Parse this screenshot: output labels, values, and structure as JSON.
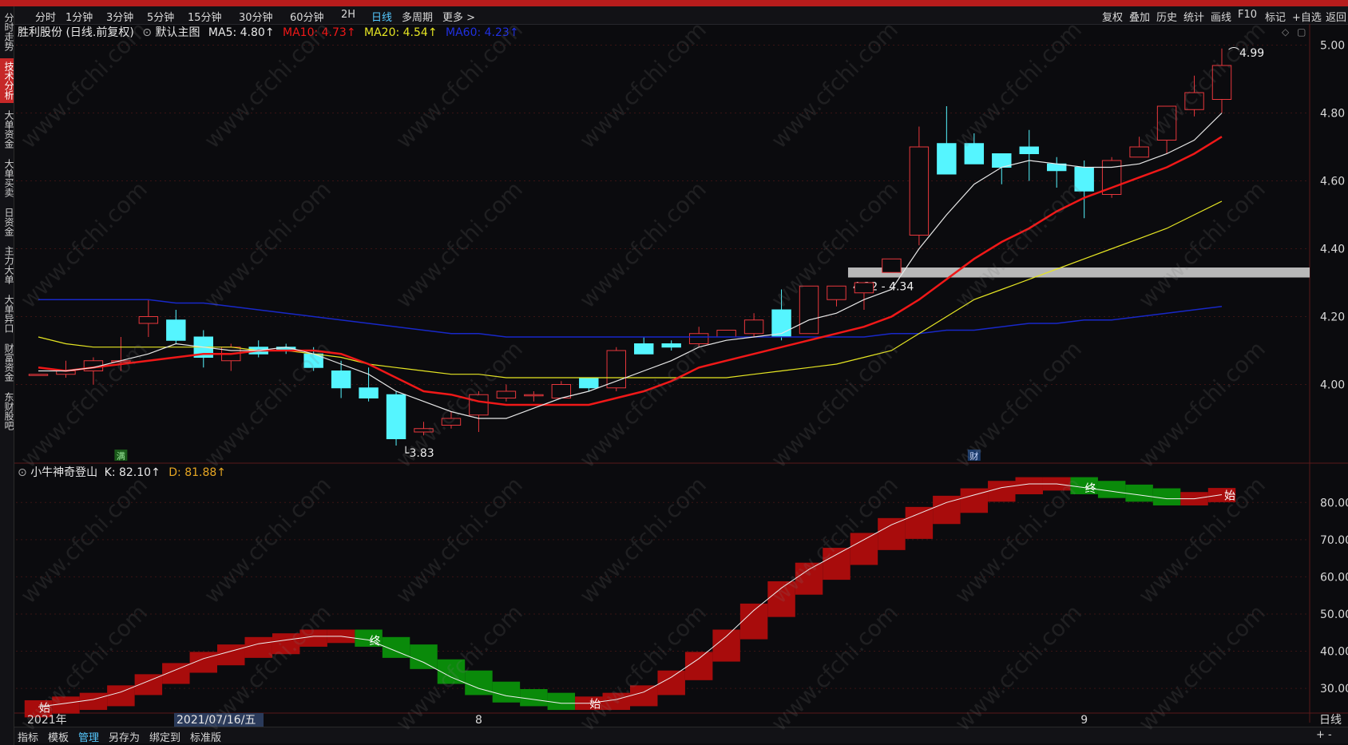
{
  "toolbar": {
    "timeframes": [
      "分时",
      "1分钟",
      "3分钟",
      "5分钟",
      "15分钟",
      "30分钟",
      "60分钟",
      "2H",
      "日线",
      "多周期",
      "更多 >"
    ],
    "active_timeframe": "日线",
    "right_buttons": [
      "复权",
      "叠加",
      "历史",
      "统计",
      "画线",
      "F10",
      "标记",
      "+自选",
      "返回"
    ]
  },
  "left_nav": [
    "分时走势",
    "技术分析",
    "大单资金",
    "大单买卖",
    "日资金",
    "主力大单",
    "大单异口",
    "财富资金",
    "东财股吧"
  ],
  "left_nav_active": "技术分析",
  "main_header": {
    "title": "胜利股份 (日线.前复权)",
    "indicator": "默认主图",
    "ma5": "MA5: 4.80↑",
    "ma10": "MA10: 4.73↑",
    "ma20": "MA20: 4.54↑",
    "ma60": "MA60: 4.23↑"
  },
  "colors": {
    "up": "#e8373c",
    "down": "#55f5ff",
    "ma5": "#e8e8e8",
    "ma10": "#f01818",
    "ma20": "#e6e623",
    "ma60": "#1828c8",
    "kbar_up": "#a80c0c",
    "kbar_down": "#0a8a0a",
    "bg": "#0b0b0e",
    "grid": "#3a1414"
  },
  "sub_header": {
    "title": "小牛神奇登山",
    "k": "K: 82.10↑",
    "d": "D: 81.88↑"
  },
  "annotations": {
    "low": "3.83",
    "high": "4.99",
    "zone": "4.32 - 4.34",
    "zone_low": 4.32,
    "zone_high": 4.34,
    "mark_man": "满",
    "mark_cai": "财",
    "sub_labels": [
      "始",
      "终",
      "始",
      "终",
      "始"
    ]
  },
  "x_axis": {
    "left": "2021年",
    "cursor_date": "2021/07/16/五",
    "month8": "8",
    "month9": "9",
    "right": "日线"
  },
  "bottom_tabs": [
    "指标",
    "模板",
    "管理",
    "另存为",
    "绑定到",
    "标准版"
  ],
  "bottom_active": "管理",
  "watermark": "www.cfchi.com",
  "chart_data": {
    "type": "candlestick",
    "price_axis": {
      "min": 3.78,
      "max": 5.02,
      "ticks": [
        4.0,
        4.2,
        4.4,
        4.6,
        4.8,
        5.0
      ]
    },
    "candles": [
      [
        4.03,
        4.03,
        4.04,
        4.04
      ],
      [
        4.03,
        4.04,
        4.07,
        4.02
      ],
      [
        4.04,
        4.07,
        4.08,
        4.0
      ],
      [
        4.07,
        4.07,
        4.14,
        4.04
      ],
      [
        4.18,
        4.2,
        4.25,
        4.14
      ],
      [
        4.19,
        4.13,
        4.22,
        4.12
      ],
      [
        4.14,
        4.08,
        4.16,
        4.05
      ],
      [
        4.07,
        4.11,
        4.12,
        4.04
      ],
      [
        4.11,
        4.09,
        4.13,
        4.08
      ],
      [
        4.11,
        4.1,
        4.12,
        4.09
      ],
      [
        4.09,
        4.05,
        4.11,
        4.04
      ],
      [
        4.04,
        3.99,
        4.07,
        3.96
      ],
      [
        3.99,
        3.96,
        4.05,
        3.95
      ],
      [
        3.97,
        3.84,
        3.98,
        3.82
      ],
      [
        3.86,
        3.87,
        3.89,
        3.85
      ],
      [
        3.88,
        3.9,
        3.92,
        3.87
      ],
      [
        3.91,
        3.97,
        3.98,
        3.86
      ],
      [
        3.96,
        3.98,
        4.0,
        3.95
      ],
      [
        3.97,
        3.97,
        3.98,
        3.95
      ],
      [
        3.96,
        4.0,
        4.01,
        3.96
      ],
      [
        4.02,
        3.99,
        4.02,
        3.98
      ],
      [
        3.99,
        4.1,
        4.11,
        3.98
      ],
      [
        4.12,
        4.09,
        4.14,
        4.09
      ],
      [
        4.12,
        4.11,
        4.13,
        4.1
      ],
      [
        4.12,
        4.15,
        4.17,
        4.11
      ],
      [
        4.14,
        4.16,
        4.16,
        4.14
      ],
      [
        4.15,
        4.19,
        4.21,
        4.14
      ],
      [
        4.22,
        4.14,
        4.28,
        4.13
      ],
      [
        4.15,
        4.29,
        4.29,
        4.16
      ],
      [
        4.25,
        4.29,
        4.29,
        4.23
      ],
      [
        4.27,
        4.3,
        4.3,
        4.22
      ],
      [
        4.33,
        4.37,
        4.37,
        4.33
      ],
      [
        4.44,
        4.7,
        4.76,
        4.41
      ],
      [
        4.71,
        4.62,
        4.82,
        4.62
      ],
      [
        4.71,
        4.65,
        4.74,
        4.65
      ],
      [
        4.68,
        4.64,
        4.68,
        4.59
      ],
      [
        4.7,
        4.68,
        4.75,
        4.6
      ],
      [
        4.65,
        4.63,
        4.67,
        4.58
      ],
      [
        4.64,
        4.57,
        4.66,
        4.49
      ],
      [
        4.56,
        4.66,
        4.67,
        4.55
      ],
      [
        4.67,
        4.7,
        4.73,
        4.67
      ],
      [
        4.72,
        4.82,
        4.82,
        4.68
      ],
      [
        4.81,
        4.86,
        4.91,
        4.79
      ],
      [
        4.84,
        4.94,
        4.99,
        4.8
      ]
    ],
    "ma5": [
      4.04,
      4.04,
      4.05,
      4.07,
      4.09,
      4.12,
      4.11,
      4.1,
      4.1,
      4.11,
      4.09,
      4.06,
      4.03,
      3.98,
      3.95,
      3.92,
      3.9,
      3.9,
      3.93,
      3.96,
      3.98,
      4.01,
      4.04,
      4.07,
      4.11,
      4.13,
      4.14,
      4.15,
      4.19,
      4.21,
      4.25,
      4.28,
      4.4,
      4.5,
      4.59,
      4.64,
      4.66,
      4.65,
      4.64,
      4.64,
      4.65,
      4.68,
      4.72,
      4.8
    ],
    "ma10": [
      4.05,
      4.04,
      4.05,
      4.06,
      4.07,
      4.08,
      4.09,
      4.09,
      4.1,
      4.1,
      4.1,
      4.09,
      4.06,
      4.02,
      3.98,
      3.97,
      3.95,
      3.94,
      3.94,
      3.94,
      3.94,
      3.96,
      3.98,
      4.01,
      4.05,
      4.07,
      4.09,
      4.11,
      4.13,
      4.15,
      4.17,
      4.2,
      4.25,
      4.31,
      4.37,
      4.42,
      4.46,
      4.51,
      4.55,
      4.58,
      4.61,
      4.64,
      4.68,
      4.73
    ],
    "ma20": [
      4.14,
      4.12,
      4.11,
      4.11,
      4.11,
      4.11,
      4.11,
      4.11,
      4.1,
      4.1,
      4.09,
      4.08,
      4.06,
      4.05,
      4.04,
      4.03,
      4.03,
      4.02,
      4.02,
      4.02,
      4.02,
      4.02,
      4.02,
      4.02,
      4.02,
      4.02,
      4.03,
      4.04,
      4.05,
      4.06,
      4.08,
      4.1,
      4.15,
      4.2,
      4.25,
      4.28,
      4.31,
      4.34,
      4.37,
      4.4,
      4.43,
      4.46,
      4.5,
      4.54
    ],
    "ma60": [
      4.25,
      4.25,
      4.25,
      4.25,
      4.25,
      4.24,
      4.24,
      4.23,
      4.22,
      4.21,
      4.2,
      4.19,
      4.18,
      4.17,
      4.16,
      4.15,
      4.15,
      4.14,
      4.14,
      4.14,
      4.14,
      4.14,
      4.14,
      4.14,
      4.14,
      4.14,
      4.14,
      4.14,
      4.14,
      4.14,
      4.14,
      4.15,
      4.15,
      4.16,
      4.16,
      4.17,
      4.18,
      4.18,
      4.19,
      4.19,
      4.2,
      4.21,
      4.22,
      4.23
    ],
    "indicator_axis": {
      "min": 24,
      "max": 88,
      "ticks": [
        30.0,
        40.0,
        50.0,
        60.0,
        70.0,
        80.0
      ]
    },
    "k": [
      25,
      26,
      27,
      29,
      32,
      35,
      38,
      40,
      42,
      43,
      44,
      44,
      43,
      40,
      37,
      33,
      30,
      28,
      27,
      26,
      26,
      27,
      29,
      33,
      38,
      44,
      51,
      57,
      62,
      66,
      70,
      74,
      77,
      80,
      82,
      84,
      85,
      85,
      84,
      83,
      82,
      81,
      81,
      82.1
    ],
    "d": [
      24,
      25,
      26,
      27,
      30,
      33,
      36,
      38,
      40,
      41,
      43,
      44,
      44,
      42,
      40,
      36,
      33,
      30,
      28,
      27,
      26,
      26,
      27,
      30,
      34,
      39,
      45,
      51,
      57,
      61,
      65,
      69,
      72,
      76,
      79,
      82,
      84,
      85,
      85,
      84,
      83,
      82,
      81,
      81.88
    ]
  }
}
